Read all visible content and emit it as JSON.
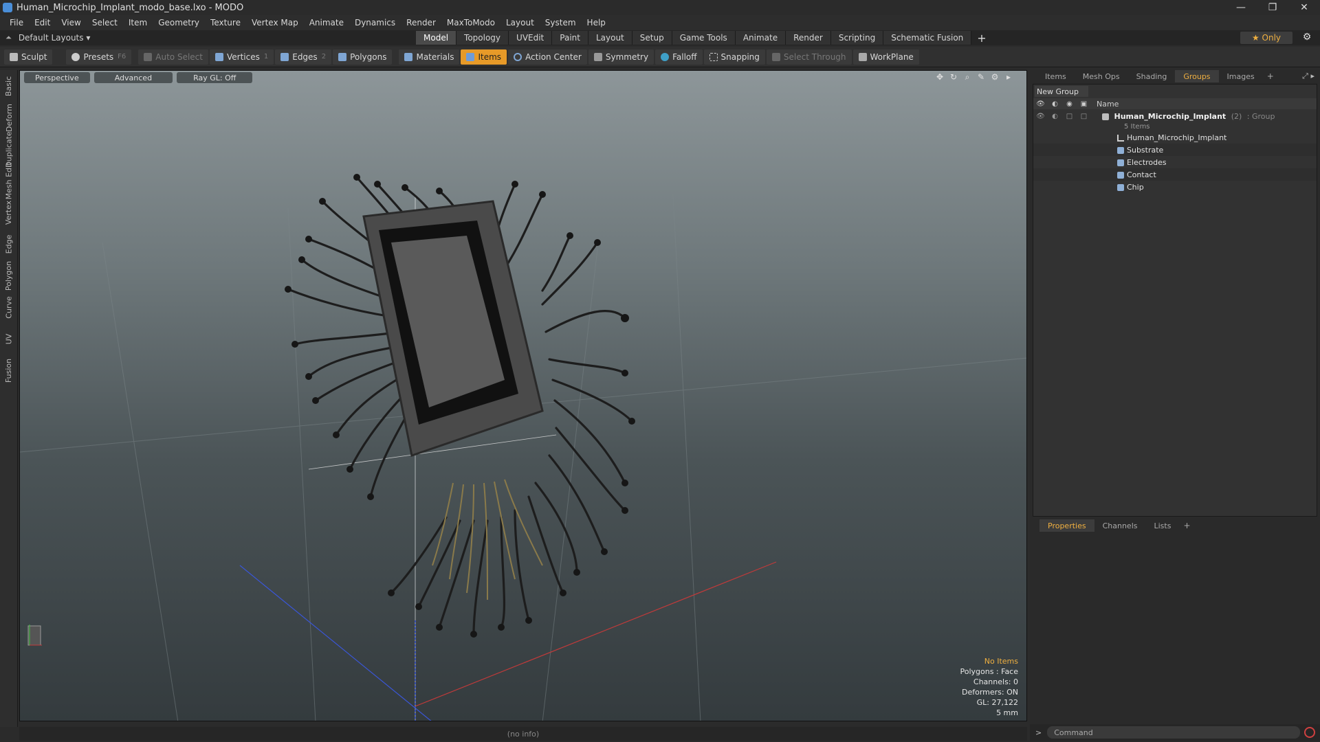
{
  "window": {
    "title": "Human_Microchip_Implant_modo_base.lxo - MODO",
    "controls": [
      "—",
      "❐",
      "✕"
    ]
  },
  "menu": [
    "File",
    "Edit",
    "View",
    "Select",
    "Item",
    "Geometry",
    "Texture",
    "Vertex Map",
    "Animate",
    "Dynamics",
    "Render",
    "MaxToModo",
    "Layout",
    "System",
    "Help"
  ],
  "layoutbar": {
    "layouts_label": "Default Layouts ▾",
    "tabs": [
      "Model",
      "Topology",
      "UVEdit",
      "Paint",
      "Layout",
      "Setup",
      "Game Tools",
      "Animate",
      "Render",
      "Scripting",
      "Schematic Fusion"
    ],
    "active_tab": "Model",
    "plus": "+",
    "only_label": "★  Only"
  },
  "toolbar": {
    "sculpt": "Sculpt",
    "presets": "Presets",
    "presets_key": "F6",
    "auto_select": "Auto Select",
    "vertices": "Vertices",
    "vertices_count": "1",
    "edges": "Edges",
    "edges_count": "2",
    "polygons": "Polygons",
    "materials": "Materials",
    "items": "Items",
    "action_center": "Action Center",
    "symmetry": "Symmetry",
    "falloff": "Falloff",
    "snapping": "Snapping",
    "select_through": "Select Through",
    "workplane": "WorkPlane"
  },
  "left_tabs": [
    "Basic",
    "Deform",
    "Duplicate",
    "Mesh Edit",
    "Vertex",
    "Edge",
    "Polygon",
    "Curve",
    "UV",
    "Fusion"
  ],
  "viewport": {
    "view": "Perspective",
    "shading": "Advanced",
    "raygl": "Ray GL: Off",
    "info": {
      "selection": "No Items",
      "polygons": "Polygons : Face",
      "channels": "Channels: 0",
      "deformers": "Deformers: ON",
      "gl": "GL: 27,122",
      "scale": "5 mm"
    }
  },
  "status": "(no info)",
  "right_panel": {
    "tabs": [
      "Items",
      "Mesh Ops",
      "Shading",
      "Groups",
      "Images"
    ],
    "active_tab": "Groups",
    "new_group": "New Group",
    "name_header": "Name",
    "group": {
      "name": "Human_Microchip_Implant",
      "count": "(2)",
      "type": ": Group",
      "items_label": "5 Items"
    },
    "items": [
      {
        "label": "Human_Microchip_Implant",
        "kind": "locator"
      },
      {
        "label": "Substrate",
        "kind": "mesh"
      },
      {
        "label": "Electrodes",
        "kind": "mesh"
      },
      {
        "label": "Contact",
        "kind": "mesh"
      },
      {
        "label": "Chip",
        "kind": "mesh"
      }
    ]
  },
  "properties_tabs": [
    "Properties",
    "Channels",
    "Lists"
  ],
  "command_placeholder": "Command",
  "colors": {
    "accent": "#e79a28",
    "viewport_top": "#8d9699",
    "viewport_bottom": "#343b3e"
  }
}
